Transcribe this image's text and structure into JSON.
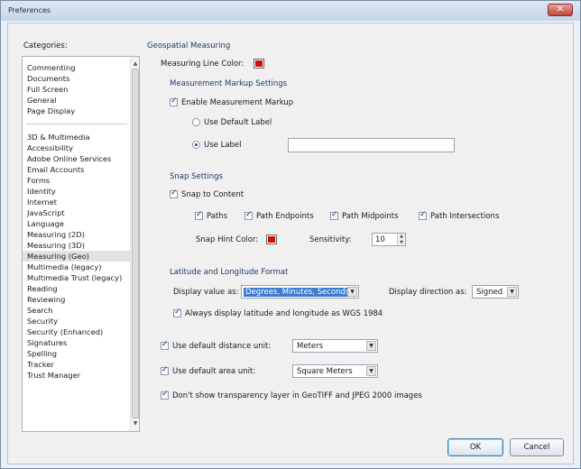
{
  "window": {
    "title": "Preferences",
    "close_symbol": "✕"
  },
  "categories": {
    "label": "Categories:",
    "group1": [
      "Commenting",
      "Documents",
      "Full Screen",
      "General",
      "Page Display"
    ],
    "group2": [
      "3D & Multimedia",
      "Accessibility",
      "Adobe Online Services",
      "Email Accounts",
      "Forms",
      "Identity",
      "Internet",
      "JavaScript",
      "Language",
      "Measuring (2D)",
      "Measuring (3D)",
      "Measuring (Geo)",
      "Multimedia (legacy)",
      "Multimedia Trust (legacy)",
      "Reading",
      "Reviewing",
      "Search",
      "Security",
      "Security (Enhanced)",
      "Signatures",
      "Spelling",
      "Tracker",
      "Trust Manager"
    ],
    "selected": "Measuring (Geo)"
  },
  "panel": {
    "title": "Geospatial Measuring",
    "line_color_label": "Measuring Line Color:",
    "line_color": "#cc1111",
    "markup": {
      "title": "Measurement Markup Settings",
      "enable_label": "Enable Measurement Markup",
      "enable_checked": true,
      "default_label": "Use Default Label",
      "use_label": "Use Label",
      "label_value": ""
    },
    "snap": {
      "title": "Snap Settings",
      "snap_to_content": "Snap to Content",
      "paths": "Paths",
      "path_endpoints": "Path Endpoints",
      "path_midpoints": "Path Midpoints",
      "path_intersections": "Path Intersections",
      "hint_color_label": "Snap Hint Color:",
      "hint_color": "#cc1111",
      "sensitivity_label": "Sensitivity:",
      "sensitivity_value": "10"
    },
    "latlon": {
      "title": "Latitude and Longitude Format",
      "display_value_label": "Display value as:",
      "display_value": "Degrees, Minutes, Seconds",
      "display_direction_label": "Display direction as:",
      "display_direction": "Signed",
      "always_wgs": "Always display latitude and longitude as WGS 1984"
    },
    "distance_unit_label": "Use default distance unit:",
    "distance_unit": "Meters",
    "area_unit_label": "Use default area unit:",
    "area_unit": "Square Meters",
    "transparency_label": "Don't show transparency layer in GeoTIFF and JPEG 2000 images"
  },
  "buttons": {
    "ok": "OK",
    "cancel": "Cancel"
  }
}
